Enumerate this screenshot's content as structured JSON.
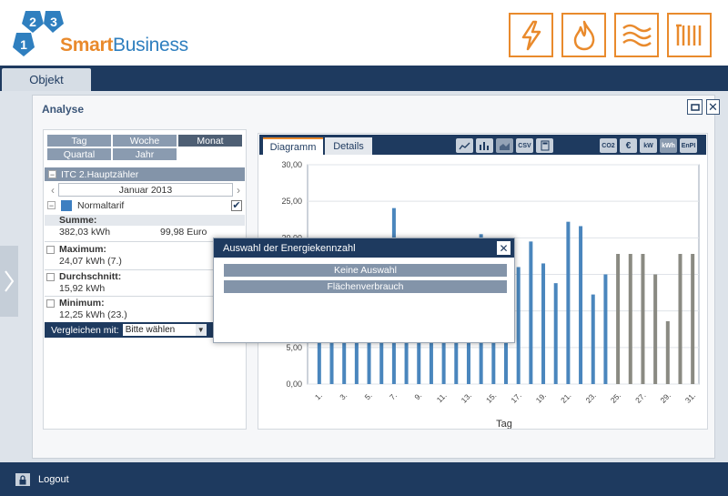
{
  "header": {
    "logo_numbers": [
      "2",
      "3",
      "1"
    ],
    "logo_smart": "Smart",
    "logo_business": "Business",
    "energy_icons": [
      "lightning-icon",
      "flame-icon",
      "heat-waves-icon",
      "radiator-icon"
    ],
    "accent_color": "#e98a2c"
  },
  "nav": {
    "tab_objekt": "Objekt"
  },
  "panel": {
    "title": "Analyse"
  },
  "period_buttons": [
    "Tag",
    "Woche",
    "Monat",
    "Quartal",
    "Jahr"
  ],
  "period_active": "Monat",
  "meter": {
    "name": "ITC 2.Hauptzähler",
    "month": "Januar 2013",
    "tarif": "Normaltarif"
  },
  "stats": {
    "summe_label": "Summe:",
    "summe_kwh": "382,03 kWh",
    "summe_euro": "99,98 Euro",
    "max_label": "Maximum:",
    "max_value": "24,07 kWh (7.)",
    "avg_label": "Durchschnitt:",
    "avg_value": "15,92 kWh",
    "min_label": "Minimum:",
    "min_value": "12,25 kWh (23.)"
  },
  "compare": {
    "label": "Vergleichen mit:",
    "value": "Bitte wählen"
  },
  "chart_tabs": [
    "Diagramm",
    "Details"
  ],
  "toolbar_left": [
    "line-chart-icon",
    "bar-chart-icon",
    "area-chart-icon",
    "csv-icon",
    "calculator-icon"
  ],
  "toolbar_left_labels": [
    "",
    "",
    "",
    "CSV",
    ""
  ],
  "toolbar_right": [
    "co2-icon",
    "euro-icon",
    "kw-icon",
    "kwh-icon",
    "enpi-icon"
  ],
  "toolbar_right_labels": [
    "CO2",
    "€",
    "kW",
    "kWh",
    "EnPI"
  ],
  "chart_data": {
    "type": "bar",
    "title": "",
    "xlabel": "Tag",
    "ylabel": "",
    "ylim": [
      0,
      30
    ],
    "yticks": [
      "0,00",
      "5,00",
      "10,00",
      "15,00",
      "20,00",
      "25,00",
      "30,00"
    ],
    "xtick_labels": [
      "1.",
      "3.",
      "5.",
      "7.",
      "9.",
      "11.",
      "13.",
      "15.",
      "17.",
      "19.",
      "21.",
      "23.",
      "25.",
      "27.",
      "29.",
      "31."
    ],
    "categories": [
      "1",
      "2",
      "3",
      "4",
      "5",
      "6",
      "7",
      "8",
      "9",
      "10",
      "11",
      "12",
      "13",
      "14",
      "15",
      "16",
      "17",
      "18",
      "19",
      "20",
      "21",
      "22",
      "23",
      "24",
      "25",
      "26",
      "27",
      "28",
      "29",
      "30",
      "31"
    ],
    "values": [
      13.0,
      13.5,
      13.5,
      14.0,
      14.0,
      14.5,
      24.07,
      14.0,
      13.5,
      13.5,
      14.0,
      14.0,
      15.0,
      20.5,
      17.0,
      16.5,
      16.0,
      19.5,
      16.5,
      13.8,
      22.2,
      21.6,
      12.25,
      15.0,
      17.8,
      17.8,
      17.8,
      15.0,
      8.6,
      17.8,
      17.8
    ],
    "series_colors": {
      "blue": "#4a86bd",
      "gray": "#8a8a82"
    },
    "gray_from_index": 24
  },
  "modal": {
    "title": "Auswahl der Energiekennzahl",
    "options": [
      "Keine Auswahl",
      "Flächenverbrauch"
    ]
  },
  "footer": {
    "logout": "Logout"
  }
}
